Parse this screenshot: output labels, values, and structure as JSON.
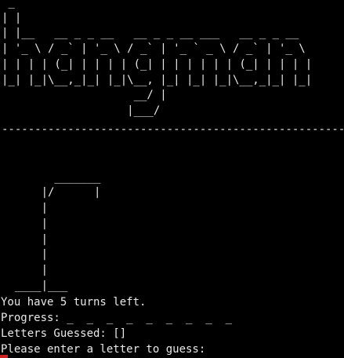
{
  "banner": {
    "ascii_art": " _\n| |\n| |__   __ _ _ __   __ _ _ __ ___   __ _ _ __\n| '_ \\ / _` | '_ \\ / _` | '_ ` _ \\ / _` | '_ \\\n| | | | (_| | | | | (_| | | | | | | (_| | | | |\n|_| |_|\\__,_|_| |_|\\__, |_| |_| |_|\\__,_|_| |_|\n                    __/ |\n                   |___/"
  },
  "separator": "-------------------------------------------------------------",
  "gallows": {
    "ascii_art": "\n        _______\n      |/      |\n      |\n      |\n      |\n      |\n      |\n  ____|___"
  },
  "status": {
    "turns_left": "You have 5 turns left.",
    "progress": "Progress: _  _  _  _  _  _  _  _  _",
    "letters_guessed": "Letters Guessed: []",
    "prompt": "Please enter a letter to guess:"
  },
  "colors": {
    "background": "#000000",
    "foreground": "#e8e8e8",
    "cursor": "#cc2222"
  }
}
